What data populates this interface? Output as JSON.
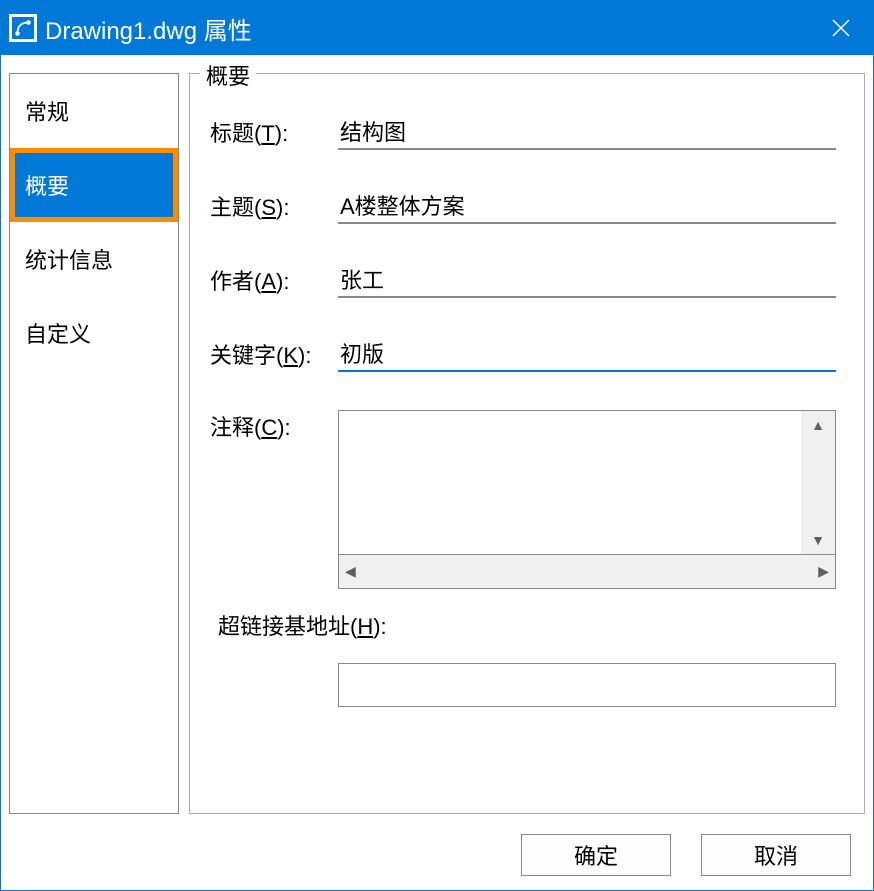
{
  "titlebar": {
    "title": "Drawing1.dwg 属性"
  },
  "sidebar": {
    "items": [
      {
        "label": "常规"
      },
      {
        "label": "概要"
      },
      {
        "label": "统计信息"
      },
      {
        "label": "自定义"
      }
    ],
    "selected_index": 1
  },
  "group": {
    "title": "概要"
  },
  "fields": {
    "title_label_prefix": "标题(",
    "title_label_key": "T",
    "title_label_suffix": "):",
    "title_value": "结构图",
    "subject_label_prefix": "主题(",
    "subject_label_key": "S",
    "subject_label_suffix": "):",
    "subject_value": "A楼整体方案",
    "author_label_prefix": "作者(",
    "author_label_key": "A",
    "author_label_suffix": "):",
    "author_value": "张工",
    "keyword_label_prefix": "关键字(",
    "keyword_label_key": "K",
    "keyword_label_suffix": "):",
    "keyword_value": "初版",
    "comment_label_prefix": "注释(",
    "comment_label_key": "C",
    "comment_label_suffix": "):",
    "comment_value": "",
    "hyperlink_label_prefix": "超链接基地址(",
    "hyperlink_label_key": "H",
    "hyperlink_label_suffix": "):",
    "hyperlink_value": ""
  },
  "footer": {
    "ok": "确定",
    "cancel": "取消"
  }
}
